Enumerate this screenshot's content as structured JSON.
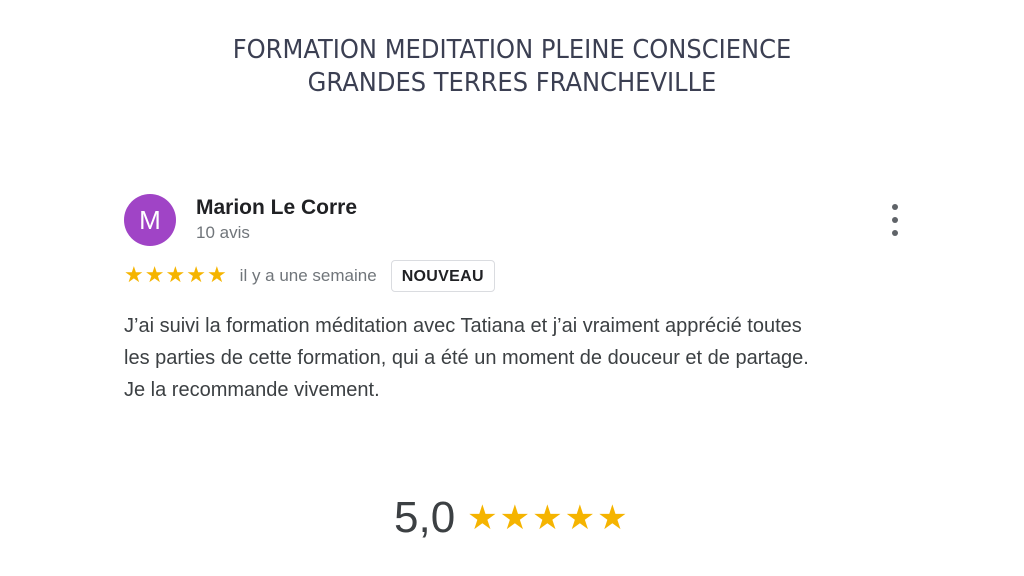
{
  "page": {
    "title_line1": "FORMATION MEDITATION PLEINE CONSCIENCE",
    "title_line2": "GRANDES TERRES FRANCHEVILLE"
  },
  "review": {
    "avatar_letter": "M",
    "avatar_color": "#a044c6",
    "author": "Marion Le Corre",
    "author_reviews": "10 avis",
    "rating": 5,
    "star_glyph": "★",
    "star_color": "#f5b400",
    "date": "il y a une semaine",
    "badge": "NOUVEAU",
    "text_lines": [
      "J’ai suivi la formation méditation avec Tatiana et j’ai vraiment apprécié toutes",
      "les parties de cette formation, qui a été un moment de douceur et de partage.",
      "Je la recommande vivement."
    ],
    "more_icon": "more-vertical-icon"
  },
  "summary": {
    "score": "5,0",
    "rating": 5
  }
}
